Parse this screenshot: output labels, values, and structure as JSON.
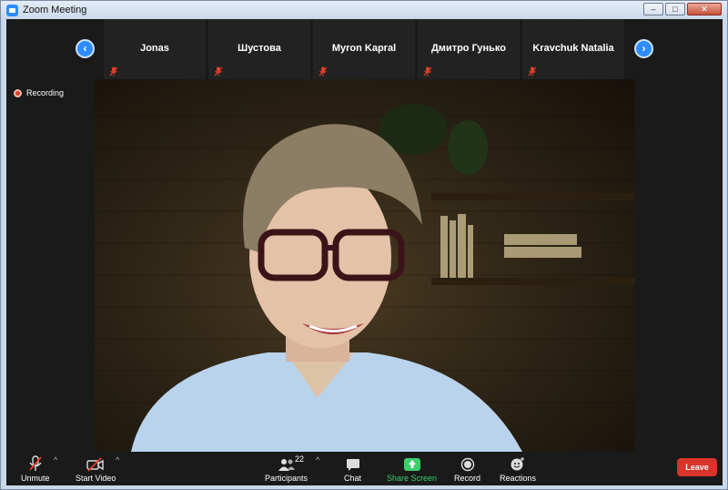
{
  "window": {
    "title": "Zoom Meeting",
    "controls": [
      "–",
      "□",
      "✕"
    ]
  },
  "strip": {
    "participants": [
      {
        "name": "Jonas"
      },
      {
        "name": "Шустова"
      },
      {
        "name": "Myron Kapral"
      },
      {
        "name": "Дмитро Гунько"
      },
      {
        "name": "Kravchuk Natalia"
      }
    ],
    "prev_glyph": "‹",
    "next_glyph": "›"
  },
  "recording": {
    "label": "Recording"
  },
  "toolbar": {
    "unmute": "Unmute",
    "start_video": "Start Video",
    "participants": "Participants",
    "participants_count": "22",
    "chat": "Chat",
    "share_screen": "Share Screen",
    "record": "Record",
    "reactions": "Reactions",
    "leave": "Leave",
    "caret": "^"
  },
  "colors": {
    "accent_blue": "#2d8cff",
    "share_green": "#3ccf6a",
    "leave_red": "#d9342b",
    "mute_red": "#e03e2d"
  },
  "icons": {
    "window": "zoom-logo-icon",
    "mute": "microphone-muted-icon",
    "video": "video-off-icon",
    "participants": "people-icon",
    "chat": "chat-bubble-icon",
    "share": "share-screen-arrow-icon",
    "record": "record-circle-icon",
    "reactions": "smiley-plus-icon"
  }
}
